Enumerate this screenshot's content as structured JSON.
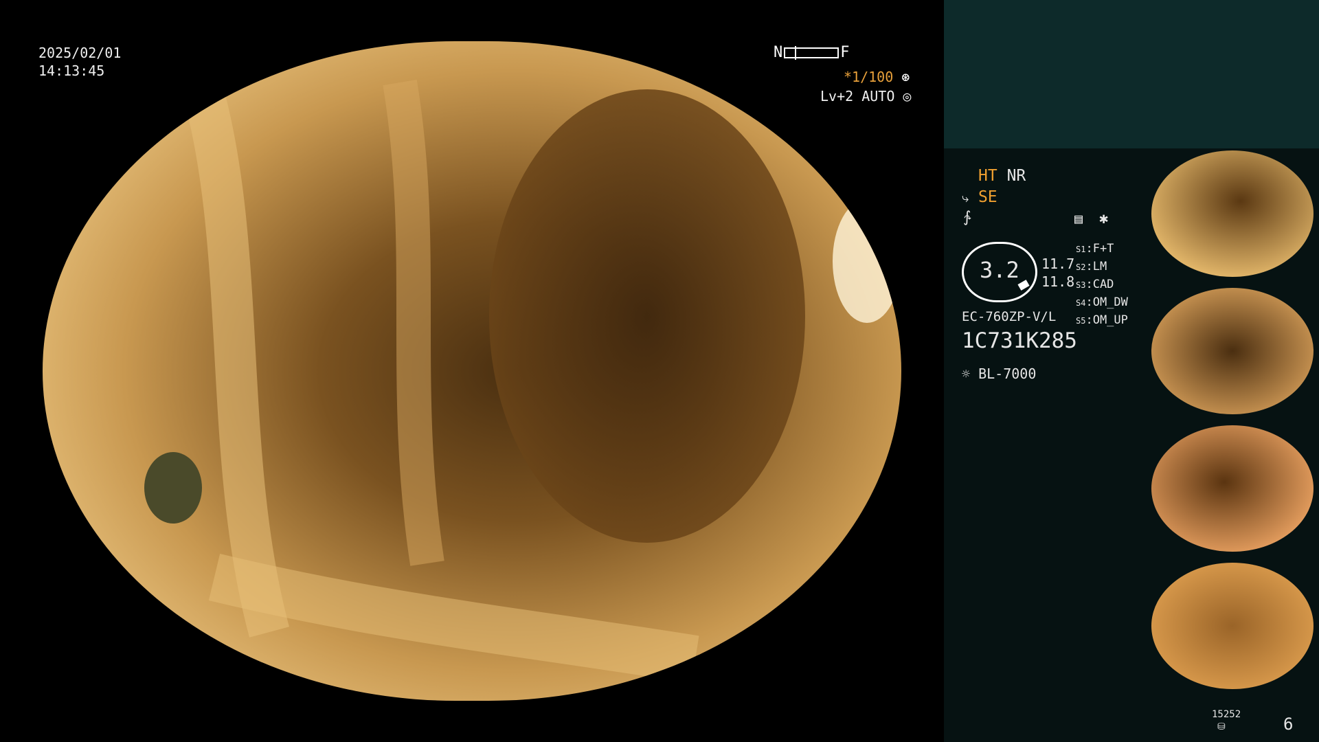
{
  "overlay": {
    "date": "2025/02/01",
    "time": "14:13:45",
    "nf_near": "N",
    "nf_far": "F",
    "shutter": "*1/100",
    "level": "Lv+2 AUTO"
  },
  "panel": {
    "ht": "HT",
    "nr": "NR",
    "se": "SE",
    "gauge_value": "3.2",
    "reading_1": "11.7",
    "reading_2": "11.8",
    "scope_model": "EC-760ZP-V/L",
    "serial": "1C731K285",
    "light_source": "BL-7000",
    "switches": [
      {
        "key": "S1",
        "value": "F+T"
      },
      {
        "key": "S2",
        "value": "LM"
      },
      {
        "key": "S3",
        "value": "CAD"
      },
      {
        "key": "S4",
        "value": "OM_DW"
      },
      {
        "key": "S5",
        "value": "OM_UP"
      }
    ],
    "image_count": "15252",
    "page_number": "6"
  },
  "thumbnails": {
    "count": 4,
    "label": "1C731K285"
  },
  "colors": {
    "panel_top": "#0d2a2a",
    "panel_bg": "#061212",
    "accent": "#f0a030"
  }
}
